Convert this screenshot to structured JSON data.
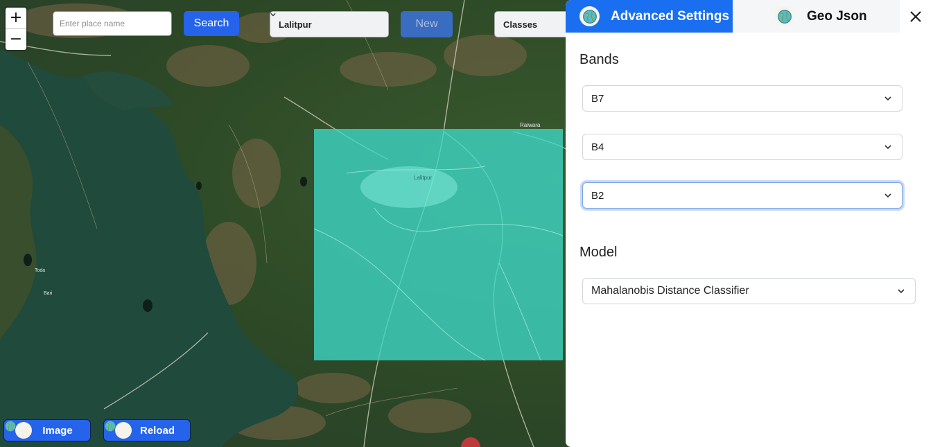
{
  "map": {
    "zoom_in": "+",
    "zoom_out": "−",
    "search": {
      "placeholder": "Enter place name",
      "value": "",
      "button_label": "Search"
    },
    "city_select": {
      "value": "Lalitpur"
    },
    "new_button_label": "New",
    "classes_select": {
      "value": "Classes"
    },
    "image_button_label": "Image",
    "reload_button_label": "Reload",
    "labels": {
      "town": "Lalitpur",
      "raiwara": "Raiwara",
      "toda": "Toda",
      "bari": "Bari"
    },
    "overlay_color": "#3ed8c8"
  },
  "panel": {
    "tabs": [
      {
        "label": "Advanced Settings",
        "active": true,
        "icon": "globe-icon"
      },
      {
        "label": "Geo Json",
        "active": false,
        "icon": "globe-icon"
      }
    ],
    "close_icon": "close-icon",
    "bands_title": "Bands",
    "bands": [
      {
        "value": "B7"
      },
      {
        "value": "B4"
      },
      {
        "value": "B2",
        "focused": true
      }
    ],
    "model_title": "Model",
    "model": {
      "value": "Mahalanobis Distance Classifier"
    }
  },
  "colors": {
    "accent": "#2563eb",
    "tab_active": "#1a6ff0",
    "water": "#1f4a3c",
    "land": "#2f4a26"
  }
}
